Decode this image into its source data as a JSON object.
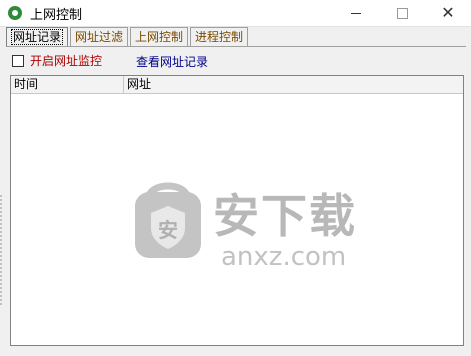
{
  "window": {
    "title": "上网控制",
    "close_glyph": "✕"
  },
  "tabs": [
    {
      "label": "网址记录",
      "active": true
    },
    {
      "label": "网址过滤",
      "active": false
    },
    {
      "label": "上网控制",
      "active": false
    },
    {
      "label": "进程控制",
      "active": false
    }
  ],
  "url_record": {
    "monitor_checkbox_label": "开启网址监控",
    "monitor_checked": false,
    "view_records_link": "查看网址记录"
  },
  "table": {
    "columns": [
      "时间",
      "网址"
    ],
    "rows": []
  },
  "watermark": {
    "title": "安下载",
    "subtitle": "anxz.com",
    "shield_char": "安"
  },
  "colors": {
    "checkbox_label": "#b00000",
    "link": "#00008b",
    "inactive_tab_text": "#7a4b00",
    "watermark": "#b8b8b8"
  }
}
